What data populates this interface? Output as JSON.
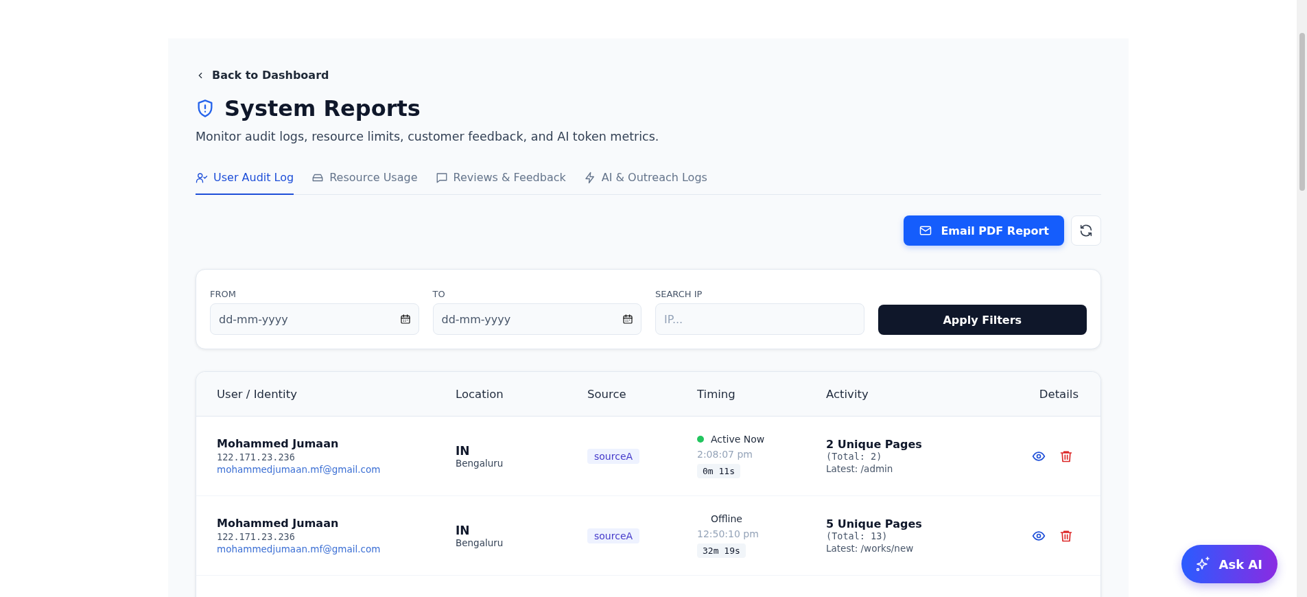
{
  "back_link": "Back to Dashboard",
  "title": "System Reports",
  "subtitle": "Monitor audit logs, resource limits, customer feedback, and AI token metrics.",
  "tabs": [
    {
      "label": "User Audit Log",
      "kind": "users",
      "selected": true
    },
    {
      "label": "Resource Usage",
      "kind": "drive",
      "selected": false
    },
    {
      "label": "Reviews & Feedback",
      "kind": "message",
      "selected": false
    },
    {
      "label": "AI & Outreach Logs",
      "kind": "bolt",
      "selected": false
    }
  ],
  "actions": {
    "email_button": "Email PDF Report"
  },
  "filters": {
    "from": {
      "label": "FROM",
      "placeholder": "dd-mm-yyyy"
    },
    "to": {
      "label": "TO",
      "placeholder": "dd-mm-yyyy"
    },
    "search_ip": {
      "label": "SEARCH IP",
      "placeholder": "IP..."
    },
    "apply_button": "Apply Filters"
  },
  "table": {
    "columns": [
      "User / Identity",
      "Location",
      "Source",
      "Timing",
      "Activity",
      "Details"
    ],
    "rows": [
      {
        "name": "Mohammed Jumaan",
        "ip": "122.171.23.236",
        "email": "mohammedjumaan.mf@gmail.com",
        "country": "IN",
        "city": "Bengaluru",
        "source": "sourceA",
        "status": "Active Now",
        "online": true,
        "time": "2:08:07 pm",
        "duration": "0m 11s",
        "pages": "2 Unique Pages",
        "total": "(Total: 2)",
        "latest": "Latest: /admin"
      },
      {
        "name": "Mohammed Jumaan",
        "ip": "122.171.23.236",
        "email": "mohammedjumaan.mf@gmail.com",
        "country": "IN",
        "city": "Bengaluru",
        "source": "sourceA",
        "status": "Offline",
        "online": false,
        "time": "12:50:10 pm",
        "duration": "32m 19s",
        "pages": "5 Unique Pages",
        "total": "(Total: 13)",
        "latest": "Latest: /works/new"
      }
    ]
  },
  "ask_ai_button": "Ask AI"
}
